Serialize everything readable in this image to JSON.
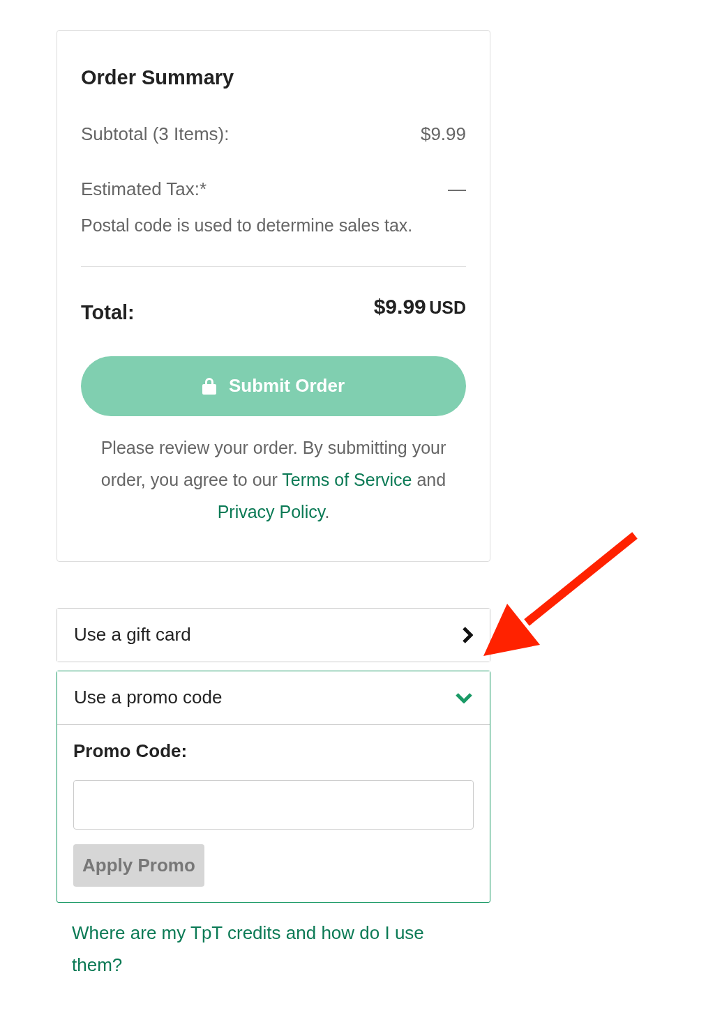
{
  "order_summary": {
    "title": "Order Summary",
    "rows": [
      {
        "label": "Subtotal",
        "count": "(3 Items):",
        "value": "$9.99"
      },
      {
        "label": "Estimated Tax:*",
        "value": "—"
      }
    ],
    "tax_note": "Postal code is used to determine sales tax.",
    "total": {
      "label": "Total:",
      "amount": "$9.99",
      "currency": "USD"
    },
    "submit_button": {
      "label": "Submit Order",
      "disabled": true
    },
    "agreement": [
      {
        "kind": "text",
        "text": "Please review your order. By submitting your order, you agree to our "
      },
      {
        "kind": "link",
        "text": "Terms of Service"
      },
      {
        "kind": "text",
        "text": " and "
      },
      {
        "kind": "link",
        "text": "Privacy Policy"
      },
      {
        "kind": "text",
        "text": "."
      }
    ]
  },
  "accordions": [
    {
      "label": "Use a gift card",
      "expanded": false
    },
    {
      "label": "Use a promo code",
      "expanded": true,
      "field_label": "Promo Code:",
      "apply_button": {
        "label": "Apply Promo",
        "disabled": true
      }
    }
  ],
  "help_link": "Where are my TpT credits and how do I use them?"
}
